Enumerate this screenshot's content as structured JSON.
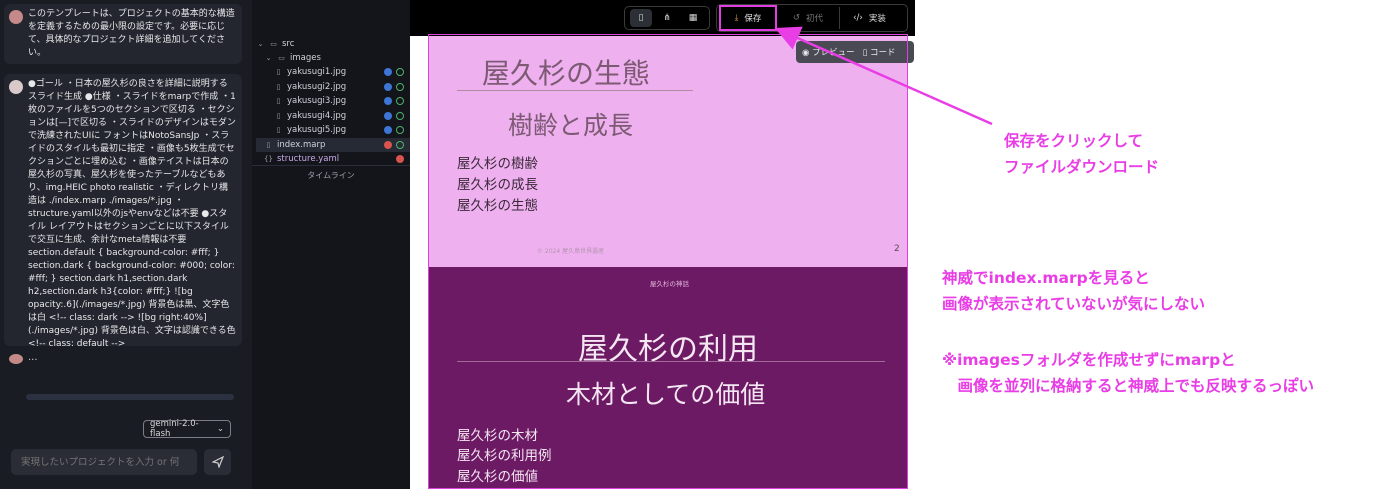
{
  "chat": {
    "messages": [
      {
        "role": "assistant",
        "text": "このテンプレートは、プロジェクトの基本的な構造を定義するための最小限の設定です。必要に応じて、具体的なプロジェクト詳細を追加してください。"
      },
      {
        "role": "user",
        "text": "●ゴール ・日本の屋久杉の良さを詳細に説明するスライド生成 ●仕様 ・スライドをmarpで作成 ・1枚のファイルを5つのセクションで区切る ・セクションは[—]で区切る ・スライドのデザインはモダンで洗練されたUIに フォントはNotoSansJp ・スライドのスタイルも最初に指定 ・画像も5枚生成でセクションごとに埋め込む ・画像テイストは日本の屋久杉の写真、屋久杉を使ったテーブルなどもあり、img.HEIC photo realistic ・ディレクトリ構造は ./index.marp ./images/*.jpg ・structure.yaml以外のjsやenvなどは不要 ●スタイル レイアウトはセクションごとに以下スタイルで交互に生成、余計なmeta情報は不要 section.default { background-color: #fff; } section.dark { background-color: #000; color: #fff; } section.dark h1,section.dark h2,section.dark h3{color: #fff;} ![bg opacity:.6](./images/*.jpg) 背景色は黒、文字色は白 <!-- class: dark --> ![bg right:40%](./images/*.jpg) 背景色は白、文字は認識できる色 <!-- class: default -->"
      },
      {
        "role": "assistant",
        "text": "..."
      }
    ],
    "model_select": "gemini-2.0-flash",
    "input_placeholder": "実現したいプロジェクトを入力 or 何"
  },
  "tree": {
    "src": "src",
    "images": "images",
    "files": [
      "yakusugi1.jpg",
      "yakusugi2.jpg",
      "yakusugi3.jpg",
      "yakusugi4.jpg",
      "yakusugi5.jpg"
    ],
    "index": "index.marp",
    "structure": "structure.yaml",
    "timeline": "タイムライン"
  },
  "toolbar": {
    "save": "保存",
    "revert": "初代",
    "implement": "実装"
  },
  "preview_tabs": {
    "preview": "プレビュー",
    "code": "コード"
  },
  "slide1": {
    "title": "屋久杉の生態",
    "subtitle": "樹齢と成長",
    "items": [
      "屋久杉の樹齢",
      "屋久杉の成長",
      "屋久杉の生態"
    ],
    "footer": "© 2024 屋久島世界遺産",
    "page": "2"
  },
  "slide2": {
    "header": "屋久杉の神話",
    "title": "屋久杉の利用",
    "subtitle": "木材としての価値",
    "items": [
      "屋久杉の木材",
      "屋久杉の利用例",
      "屋久杉の価値"
    ]
  },
  "annotations": {
    "save": [
      "保存をクリックして",
      "ファイルダウンロード"
    ],
    "kami": [
      "神威でindex.marpを見ると",
      "画像が表示されていないが気にしない"
    ],
    "note": [
      "※imagesフォルダを作成せずにmarpと",
      "　画像を並列に格納すると神威上でも反映するっぽい"
    ]
  },
  "colors": {
    "accent": "#e93de6",
    "slide_light": "#eeb0ef",
    "slide_dark": "#6d1a64",
    "chat_bg": "#1a1c23",
    "tree_bg": "#13151b"
  }
}
